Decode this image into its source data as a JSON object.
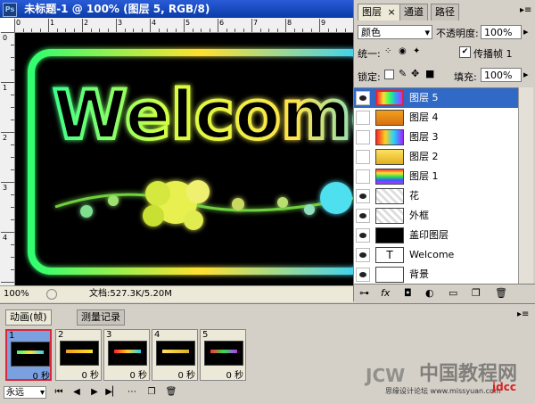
{
  "document": {
    "title": "未标题-1 @ 100% (图层 5, RGB/8)",
    "app_badge": "Ps",
    "ruler_top": [
      "0",
      "1",
      "2",
      "3",
      "4",
      "5",
      "6",
      "7",
      "8",
      "9"
    ],
    "ruler_left": [
      "0",
      "1",
      "2",
      "3",
      "4"
    ],
    "canvas_text": "Welcome",
    "zoom": "100%",
    "doc_size": "文档:527.3K/5.20M"
  },
  "layers_panel": {
    "tabs": [
      "图层",
      "通道",
      "路径"
    ],
    "tab_close": "×",
    "blend_mode": "颜色",
    "opacity_label": "不透明度:",
    "opacity": "100%",
    "unify_label": "统一:",
    "propagate_label": "传播帧 1",
    "lock_label": "锁定:",
    "fill_label": "填充:",
    "fill": "100%",
    "type_thumb": "T",
    "layers": [
      {
        "name": "图层 5",
        "visible": true,
        "selected": true
      },
      {
        "name": "图层 4",
        "visible": false,
        "selected": false
      },
      {
        "name": "图层 3",
        "visible": false,
        "selected": false
      },
      {
        "name": "图层 2",
        "visible": false,
        "selected": false
      },
      {
        "name": "图层 1",
        "visible": false,
        "selected": false
      },
      {
        "name": "花",
        "visible": true,
        "selected": false
      },
      {
        "name": "外框",
        "visible": true,
        "selected": false
      },
      {
        "name": "盖印图层",
        "visible": true,
        "selected": false
      },
      {
        "name": "Welcome",
        "visible": true,
        "selected": false
      },
      {
        "name": "背景",
        "visible": true,
        "selected": false
      }
    ]
  },
  "animation_panel": {
    "tabs": [
      "动画(帧)",
      "测量记录"
    ],
    "loop": "永远",
    "frames": [
      {
        "number": "1",
        "delay": "0 秒"
      },
      {
        "number": "2",
        "delay": "0 秒"
      },
      {
        "number": "3",
        "delay": "0 秒"
      },
      {
        "number": "4",
        "delay": "0 秒"
      },
      {
        "number": "5",
        "delay": "0 秒"
      }
    ]
  },
  "watermark": {
    "site": "中国教程网",
    "small": "思缘设计论坛 www.missyuan.com",
    "jcw": "JCW",
    "jdcc": "jdcc"
  }
}
